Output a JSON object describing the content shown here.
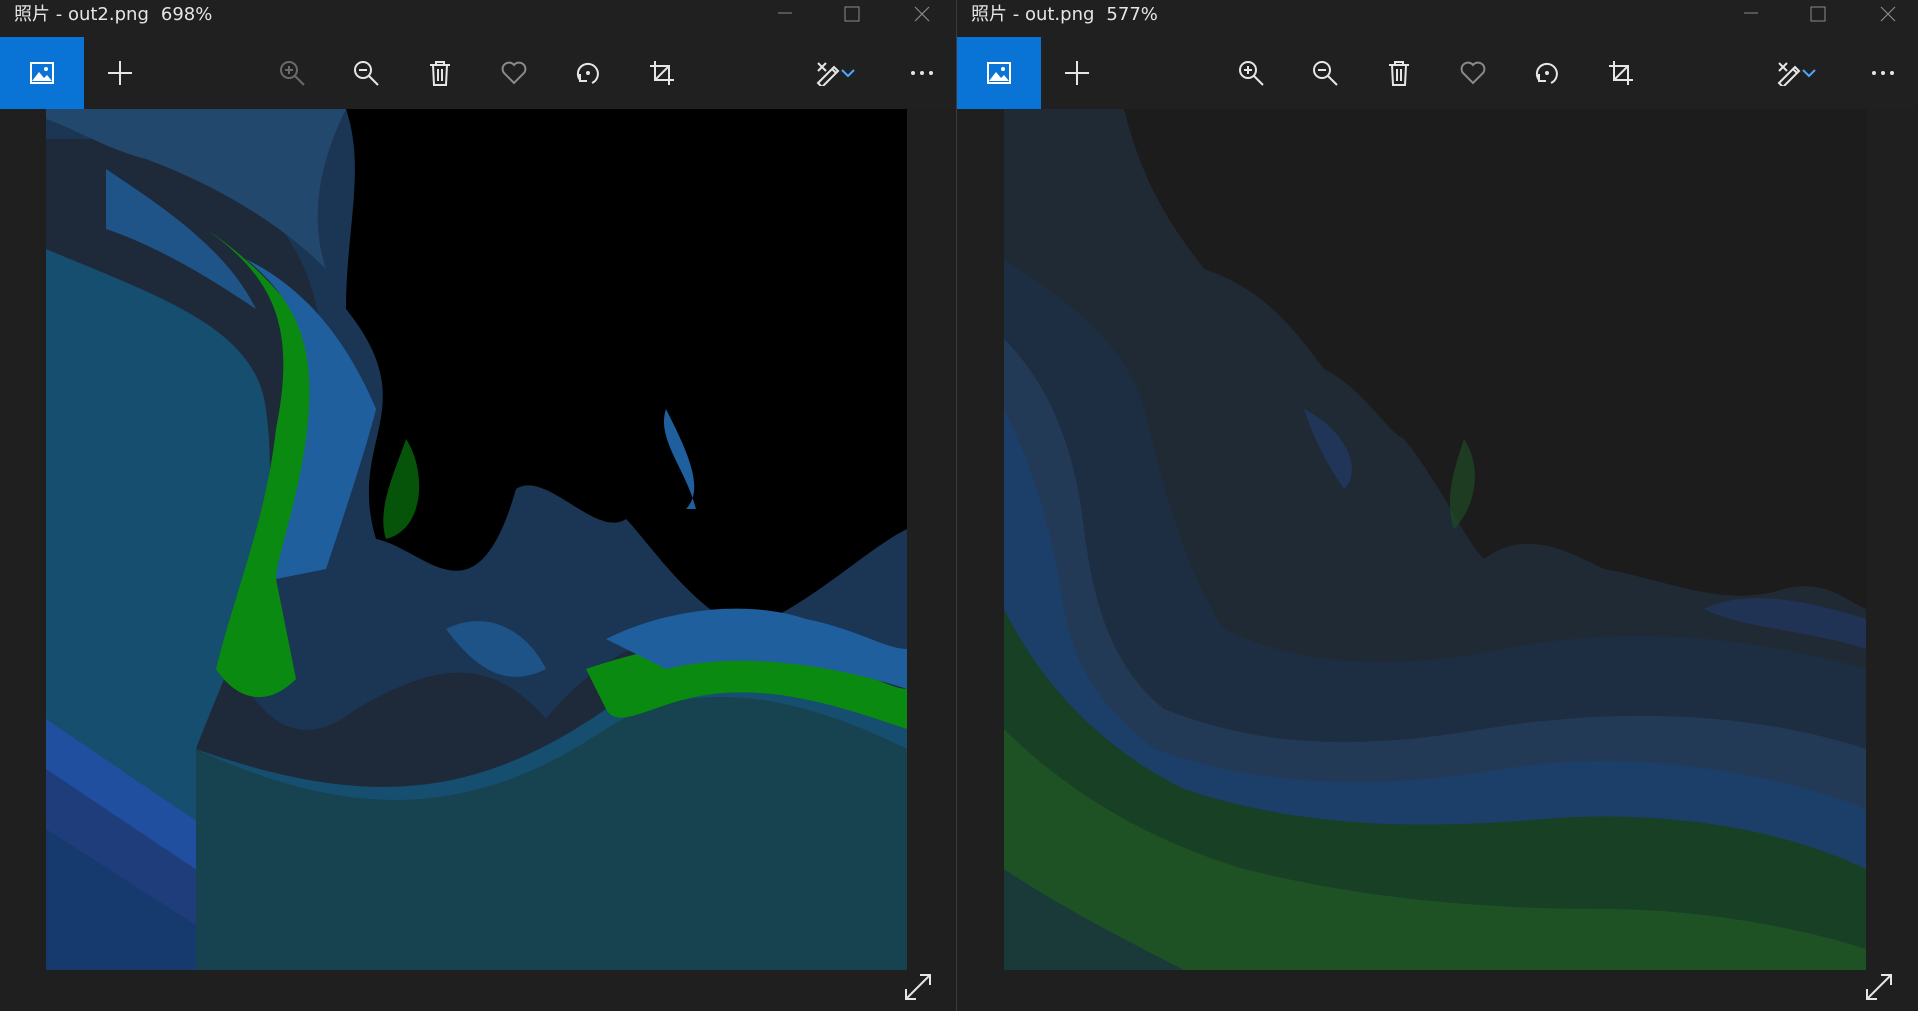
{
  "left_window": {
    "app_name": "照片",
    "separator": " - ",
    "file_name": "out2.png",
    "zoom_level": "698%",
    "image_palette": [
      "#000000",
      "#1e2a3a",
      "#1b3654",
      "#23486d",
      "#1f5f9e",
      "#0e6e1c",
      "#0a8a10",
      "#154e6e",
      "#1f3d7a"
    ]
  },
  "right_window": {
    "app_name": "",
    "separator": "",
    "file_name": "out.png",
    "zoom_level": "577%",
    "image_palette": [
      "#1c1c1c",
      "#202a34",
      "#1e2e42",
      "#223a55",
      "#1c3f6a",
      "#174024",
      "#1e5225",
      "#1a3a3a",
      "#223a6a"
    ]
  },
  "toolbar": {
    "accent_color": "#0a74d6",
    "icons": [
      "photo-icon",
      "add-icon",
      "zoom-in-icon",
      "zoom-out-icon",
      "delete-icon",
      "heart-icon",
      "rotate-icon",
      "crop-icon",
      "edit-draw-icon",
      "chevron-down-icon",
      "more-icon"
    ]
  },
  "window_controls": [
    "minimize-icon",
    "maximize-icon",
    "close-icon"
  ]
}
